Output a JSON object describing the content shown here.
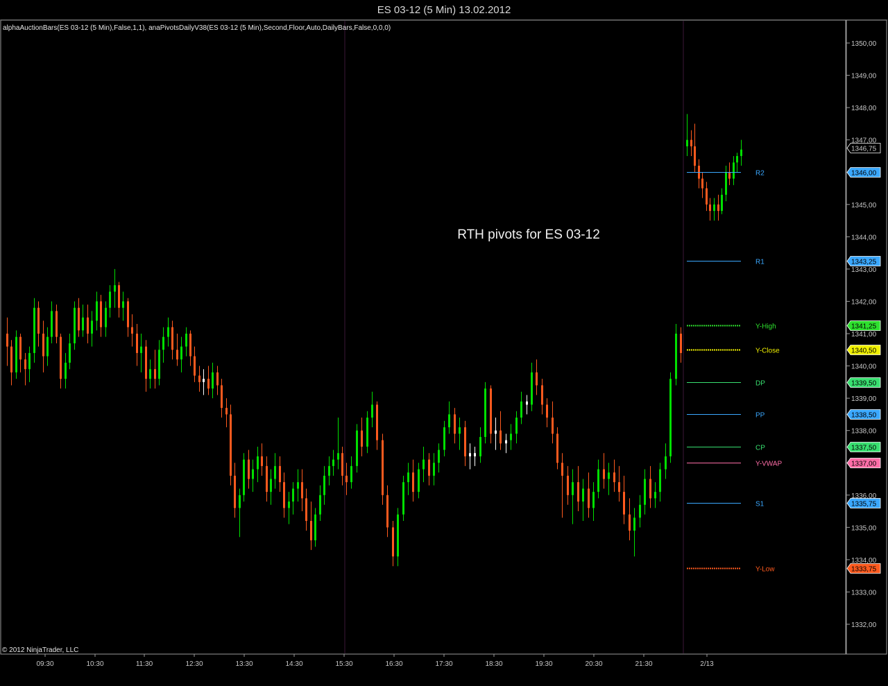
{
  "window": {
    "title": "ES 03-12 (5 Min)  13.02.2012"
  },
  "indicator_label": "alphaAuctionBars(ES 03-12 (5 Min),False,1,1), anaPivotsDailyV38(ES 03-12 (5 Min),Second,Floor,Auto,DailyBars,False,0,0,0)",
  "copyright": "© 2012 NinjaTrader, LLC",
  "annotation": "RTH pivots for ES 03-12",
  "colors": {
    "background": "#000000",
    "up": "#00e000",
    "down": "#ff5a1e",
    "doji": "#ffffff",
    "session_divider": "#3c1838",
    "axis": "#c8c8c8"
  },
  "chart_data": {
    "type": "candlestick",
    "ylim": [
      1331.5,
      1350.5
    ],
    "y_ticks": [
      "1350,00",
      "1349,00",
      "1348,00",
      "1347,00",
      "1346,00",
      "1345,00",
      "1344,00",
      "1343,00",
      "1342,00",
      "1341,00",
      "1340,00",
      "1339,00",
      "1338,00",
      "1337,00",
      "1336,00",
      "1335,00",
      "1334,00",
      "1333,00",
      "1332,00"
    ],
    "x_ticks": [
      "09:30",
      "10:30",
      "11:30",
      "12:30",
      "13:30",
      "14:30",
      "15:30",
      "16:30",
      "17:30",
      "18:30",
      "19:30",
      "20:30",
      "21:30",
      "2/13"
    ],
    "grid": false,
    "session_dividers": [
      "15:30",
      "2/13"
    ],
    "price_series": {
      "prev_day": [
        [
          1341.0,
          1341.5,
          1340.0,
          1340.6
        ],
        [
          1340.6,
          1340.8,
          1339.4,
          1339.8
        ],
        [
          1339.8,
          1341.1,
          1339.6,
          1340.9
        ],
        [
          1340.9,
          1341.0,
          1339.8,
          1340.2
        ],
        [
          1340.2,
          1340.4,
          1339.4,
          1339.9
        ],
        [
          1339.9,
          1340.6,
          1339.5,
          1340.4
        ],
        [
          1340.4,
          1342.1,
          1340.1,
          1341.8
        ],
        [
          1341.8,
          1342.0,
          1340.6,
          1341.0
        ],
        [
          1341.0,
          1341.4,
          1339.8,
          1340.3
        ],
        [
          1340.3,
          1341.2,
          1340.0,
          1340.9
        ],
        [
          1340.9,
          1342.0,
          1340.7,
          1341.7
        ],
        [
          1341.7,
          1341.9,
          1340.7,
          1340.9
        ],
        [
          1340.9,
          1341.0,
          1339.3,
          1339.6
        ],
        [
          1339.6,
          1340.4,
          1339.3,
          1340.1
        ],
        [
          1340.1,
          1341.0,
          1339.9,
          1340.7
        ],
        [
          1340.7,
          1342.0,
          1340.5,
          1341.8
        ],
        [
          1341.8,
          1342.1,
          1340.9,
          1341.1
        ],
        [
          1341.1,
          1341.9,
          1340.9,
          1341.5
        ],
        [
          1341.5,
          1341.9,
          1340.7,
          1341.0
        ],
        [
          1341.0,
          1341.7,
          1340.6,
          1341.4
        ],
        [
          1341.4,
          1342.3,
          1341.1,
          1342.0
        ],
        [
          1342.0,
          1342.2,
          1340.9,
          1341.2
        ],
        [
          1341.2,
          1342.0,
          1340.9,
          1341.8
        ],
        [
          1341.8,
          1342.5,
          1341.5,
          1342.3
        ],
        [
          1342.3,
          1343.0,
          1341.8,
          1342.5
        ],
        [
          1342.5,
          1342.6,
          1341.5,
          1341.8
        ],
        [
          1341.8,
          1342.3,
          1341.4,
          1342.0
        ],
        [
          1342.0,
          1342.1,
          1340.9,
          1341.2
        ],
        [
          1341.2,
          1341.6,
          1340.6,
          1341.0
        ],
        [
          1341.0,
          1341.3,
          1340.0,
          1340.4
        ],
        [
          1340.4,
          1341.0,
          1339.8,
          1340.6
        ],
        [
          1340.6,
          1340.8,
          1339.2,
          1339.6
        ],
        [
          1339.6,
          1340.2,
          1339.3,
          1339.9
        ],
        [
          1339.9,
          1340.5,
          1339.3,
          1339.6
        ],
        [
          1339.6,
          1340.8,
          1339.4,
          1340.5
        ],
        [
          1340.5,
          1341.2,
          1340.1,
          1340.9
        ],
        [
          1340.9,
          1341.5,
          1340.6,
          1341.2
        ],
        [
          1341.2,
          1341.4,
          1340.2,
          1340.5
        ],
        [
          1340.5,
          1341.0,
          1340.0,
          1340.2
        ],
        [
          1340.2,
          1340.9,
          1339.8,
          1340.6
        ],
        [
          1340.6,
          1341.2,
          1340.3,
          1341.0
        ],
        [
          1341.0,
          1341.1,
          1340.0,
          1340.3
        ],
        [
          1340.3,
          1340.6,
          1339.5,
          1339.7
        ],
        [
          1339.7,
          1340.0,
          1339.2,
          1339.5
        ],
        [
          1339.5,
          1339.9,
          1339.1,
          1339.6
        ],
        [
          1339.6,
          1340.0,
          1339.1,
          1339.3
        ],
        [
          1339.3,
          1340.1,
          1339.0,
          1339.8
        ],
        [
          1339.8,
          1340.0,
          1339.1,
          1339.4
        ],
        [
          1339.4,
          1339.6,
          1338.4,
          1338.7
        ],
        [
          1338.7,
          1339.0,
          1338.1,
          1338.5
        ],
        [
          1338.5,
          1338.8,
          1336.3,
          1336.6
        ],
        [
          1336.6,
          1337.0,
          1335.3,
          1335.6
        ],
        [
          1335.6,
          1336.2,
          1334.7,
          1336.0
        ],
        [
          1336.0,
          1337.3,
          1335.8,
          1337.1
        ],
        [
          1337.1,
          1337.4,
          1336.2,
          1336.5
        ],
        [
          1336.5,
          1337.1,
          1336.1,
          1336.8
        ],
        [
          1336.8,
          1337.5,
          1336.4,
          1337.2
        ],
        [
          1337.2,
          1337.6,
          1336.6,
          1336.9
        ],
        [
          1336.9,
          1337.2,
          1335.8,
          1336.1
        ],
        [
          1336.1,
          1336.8,
          1335.7,
          1336.5
        ],
        [
          1336.5,
          1337.3,
          1336.2,
          1336.9
        ],
        [
          1336.9,
          1337.2,
          1336.1,
          1336.4
        ],
        [
          1336.4,
          1336.7,
          1335.3,
          1335.6
        ],
        [
          1335.6,
          1336.1,
          1335.1,
          1335.8
        ],
        [
          1335.8,
          1336.4,
          1335.4,
          1336.2
        ],
        [
          1336.2,
          1336.8,
          1335.8,
          1336.4
        ],
        [
          1336.4,
          1336.8,
          1335.5,
          1335.9
        ],
        [
          1335.9,
          1336.2,
          1334.9,
          1335.2
        ],
        [
          1335.2,
          1335.8,
          1334.3,
          1334.6
        ],
        [
          1334.6,
          1335.6,
          1334.4,
          1335.4
        ],
        [
          1335.4,
          1336.3,
          1335.2,
          1336.0
        ],
        [
          1336.0,
          1336.9,
          1335.7,
          1336.6
        ],
        [
          1336.6,
          1337.2,
          1336.3,
          1336.9
        ],
        [
          1336.9,
          1337.4,
          1336.6,
          1337.1
        ],
        [
          1337.1,
          1338.4,
          1336.8,
          1337.3
        ],
        [
          1337.3,
          1337.5,
          1336.3,
          1336.6
        ]
      ],
      "overnight": [
        [
          1336.6,
          1337.0,
          1336.0,
          1336.4
        ],
        [
          1336.4,
          1337.2,
          1336.2,
          1336.9
        ],
        [
          1336.9,
          1338.2,
          1336.7,
          1338.0
        ],
        [
          1338.0,
          1338.4,
          1337.2,
          1337.5
        ],
        [
          1337.5,
          1338.6,
          1337.3,
          1338.4
        ],
        [
          1338.4,
          1339.2,
          1338.1,
          1338.8
        ],
        [
          1338.8,
          1338.9,
          1337.4,
          1337.7
        ],
        [
          1337.7,
          1337.9,
          1335.7,
          1336.0
        ],
        [
          1336.0,
          1336.3,
          1334.7,
          1335.0
        ],
        [
          1335.0,
          1335.2,
          1333.8,
          1334.1
        ],
        [
          1334.1,
          1335.6,
          1333.8,
          1335.4
        ],
        [
          1335.4,
          1336.6,
          1335.2,
          1336.4
        ],
        [
          1336.4,
          1337.0,
          1336.0,
          1336.7
        ],
        [
          1336.7,
          1337.1,
          1335.8,
          1336.1
        ],
        [
          1336.1,
          1337.0,
          1335.9,
          1336.8
        ],
        [
          1336.8,
          1337.5,
          1336.4,
          1337.1
        ],
        [
          1337.1,
          1337.3,
          1336.3,
          1336.6
        ],
        [
          1336.6,
          1337.3,
          1336.3,
          1337.0
        ],
        [
          1337.0,
          1337.6,
          1336.7,
          1337.4
        ],
        [
          1337.4,
          1338.3,
          1337.2,
          1338.1
        ],
        [
          1338.1,
          1338.9,
          1337.9,
          1338.5
        ],
        [
          1338.5,
          1338.7,
          1337.6,
          1337.9
        ],
        [
          1337.9,
          1338.4,
          1337.4,
          1338.1
        ],
        [
          1338.1,
          1338.3,
          1336.9,
          1337.2
        ],
        [
          1337.2,
          1337.6,
          1336.8,
          1337.3
        ],
        [
          1337.3,
          1337.5,
          1336.9,
          1337.2
        ],
        [
          1337.2,
          1338.1,
          1337.0,
          1337.8
        ],
        [
          1337.8,
          1339.5,
          1337.6,
          1339.3
        ],
        [
          1339.3,
          1339.4,
          1337.6,
          1337.9
        ],
        [
          1337.9,
          1338.4,
          1337.4,
          1338.0
        ],
        [
          1338.0,
          1338.6,
          1337.4,
          1337.6
        ],
        [
          1337.6,
          1337.9,
          1337.3,
          1337.7
        ],
        [
          1337.7,
          1338.2,
          1337.4,
          1337.9
        ],
        [
          1337.9,
          1338.6,
          1337.6,
          1338.4
        ],
        [
          1338.4,
          1339.2,
          1338.2,
          1338.9
        ],
        [
          1338.9,
          1339.1,
          1338.5,
          1338.8
        ],
        [
          1338.8,
          1340.1,
          1338.6,
          1339.8
        ],
        [
          1339.8,
          1340.2,
          1339.1,
          1339.4
        ],
        [
          1339.4,
          1339.6,
          1338.5,
          1338.8
        ],
        [
          1338.8,
          1339.0,
          1338.1,
          1338.4
        ],
        [
          1338.4,
          1338.9,
          1337.6,
          1337.9
        ],
        [
          1337.9,
          1338.1,
          1336.8,
          1337.0
        ],
        [
          1337.0,
          1337.3,
          1335.3,
          1336.6
        ],
        [
          1336.6,
          1336.9,
          1335.7,
          1336.0
        ],
        [
          1336.0,
          1336.8,
          1335.1,
          1336.4
        ],
        [
          1336.4,
          1336.9,
          1335.5,
          1335.8
        ],
        [
          1335.8,
          1336.5,
          1335.2,
          1336.2
        ],
        [
          1336.2,
          1336.7,
          1335.3,
          1335.6
        ],
        [
          1335.6,
          1336.4,
          1335.2,
          1336.1
        ],
        [
          1336.1,
          1337.1,
          1335.9,
          1336.8
        ],
        [
          1336.8,
          1337.3,
          1336.2,
          1336.5
        ],
        [
          1336.5,
          1337.0,
          1336.0,
          1336.7
        ],
        [
          1336.7,
          1337.1,
          1336.1,
          1336.4
        ],
        [
          1336.4,
          1336.9,
          1335.8,
          1336.1
        ],
        [
          1336.1,
          1336.6,
          1335.1,
          1335.4
        ],
        [
          1335.4,
          1335.9,
          1334.6,
          1334.9
        ],
        [
          1334.9,
          1335.6,
          1334.1,
          1335.3
        ],
        [
          1335.3,
          1336.0,
          1335.0,
          1335.7
        ],
        [
          1335.7,
          1336.8,
          1335.4,
          1336.5
        ],
        [
          1336.5,
          1336.9,
          1335.6,
          1335.9
        ],
        [
          1335.9,
          1336.4,
          1335.6,
          1336.1
        ],
        [
          1336.1,
          1337.0,
          1335.8,
          1336.8
        ],
        [
          1336.8,
          1337.6,
          1336.5,
          1337.2
        ],
        [
          1337.2,
          1339.8,
          1337.0,
          1339.6
        ],
        [
          1339.6,
          1341.3,
          1339.4,
          1341.0
        ],
        [
          1341.0,
          1341.2,
          1340.1,
          1340.4
        ]
      ],
      "current_day": [
        [
          1346.8,
          1347.8,
          1346.5,
          1347.0
        ],
        [
          1347.0,
          1347.3,
          1346.5,
          1346.8
        ],
        [
          1346.8,
          1347.5,
          1346.0,
          1346.2
        ],
        [
          1346.2,
          1346.4,
          1345.5,
          1345.8
        ],
        [
          1345.8,
          1346.0,
          1345.2,
          1345.5
        ],
        [
          1345.5,
          1345.7,
          1344.8,
          1345.0
        ],
        [
          1345.0,
          1345.2,
          1344.5,
          1344.8
        ],
        [
          1344.8,
          1345.2,
          1344.5,
          1345.0
        ],
        [
          1345.0,
          1345.3,
          1344.5,
          1344.8
        ],
        [
          1344.8,
          1345.5,
          1344.7,
          1345.3
        ],
        [
          1345.3,
          1346.2,
          1345.1,
          1346.0
        ],
        [
          1346.0,
          1346.3,
          1345.6,
          1345.8
        ],
        [
          1345.8,
          1346.5,
          1345.6,
          1346.3
        ],
        [
          1346.3,
          1346.6,
          1346.0,
          1346.5
        ],
        [
          1346.5,
          1347.0,
          1346.2,
          1346.7
        ]
      ]
    },
    "pivot_levels": [
      {
        "name": "R2",
        "value": 1346.0,
        "tag": "1346,00",
        "color": "#3aa8ff"
      },
      {
        "name": "R1",
        "value": 1343.25,
        "tag": "1343,25",
        "color": "#3aa8ff"
      },
      {
        "name": "Y-High",
        "value": 1341.25,
        "tag": "1341,25",
        "color": "#2ee02e"
      },
      {
        "name": "Y-Close",
        "value": 1340.5,
        "tag": "1340,50",
        "color": "#f0f000"
      },
      {
        "name": "DP",
        "value": 1339.5,
        "tag": "1339,50",
        "color": "#38e070"
      },
      {
        "name": "PP",
        "value": 1338.5,
        "tag": "1338,50",
        "color": "#3aa8ff"
      },
      {
        "name": "CP",
        "value": 1337.5,
        "tag": "1337,50",
        "color": "#38e070"
      },
      {
        "name": "Y-VWAP",
        "value": 1337.0,
        "tag": "1337,00",
        "color": "#ff6ea8"
      },
      {
        "name": "S1",
        "value": 1335.75,
        "tag": "1335,75",
        "color": "#3aa8ff"
      },
      {
        "name": "Y-Low",
        "value": 1333.75,
        "tag": "1333,75",
        "color": "#ff5a1e"
      }
    ],
    "last_price": {
      "value": 1346.75,
      "tag": "1346,75"
    }
  }
}
